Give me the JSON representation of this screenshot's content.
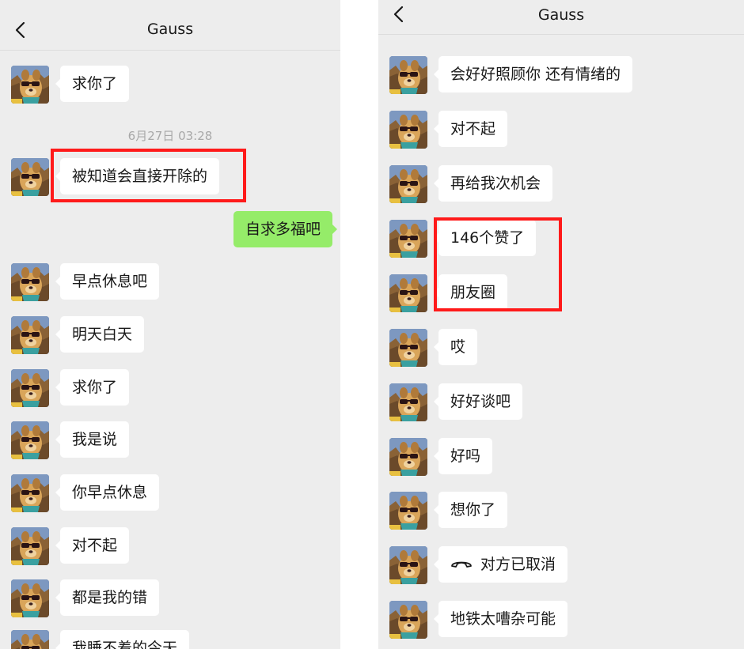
{
  "left": {
    "title": "Gauss",
    "timestamp": "6月27日 03:28",
    "messages_before": [
      {
        "text": "求你了"
      }
    ],
    "highlighted_message": {
      "text": "被知道会直接开除的"
    },
    "outgoing_message": {
      "text": "自求多福吧"
    },
    "messages_after": [
      {
        "text": "早点休息吧"
      },
      {
        "text": "明天白天"
      },
      {
        "text": "求你了"
      },
      {
        "text": "我是说"
      },
      {
        "text": "你早点休息"
      },
      {
        "text": "对不起"
      },
      {
        "text": "都是我的错"
      },
      {
        "text": "我睡不着的今天"
      }
    ]
  },
  "right": {
    "title": "Gauss",
    "messages": [
      {
        "text": "会好好照顾你 还有情绪的"
      },
      {
        "text": "对不起"
      },
      {
        "text": "再给我次机会"
      },
      {
        "text": "146个赞了"
      },
      {
        "text": "朋友圈"
      },
      {
        "text": "哎"
      },
      {
        "text": "好好谈吧"
      },
      {
        "text": "好吗"
      },
      {
        "text": "想你了"
      },
      {
        "text": "对方已取消",
        "icon": "phone-hangup-icon"
      },
      {
        "text": "地铁太嘈杂可能"
      }
    ]
  },
  "colors": {
    "background": "#ededed",
    "incoming_bubble": "#ffffff",
    "outgoing_bubble": "#95ec69",
    "highlight": "#ff1a1a"
  },
  "icons": {
    "back": "chevron-left-icon",
    "call": "phone-hangup-icon",
    "avatar": "dog-avatar-icon"
  }
}
